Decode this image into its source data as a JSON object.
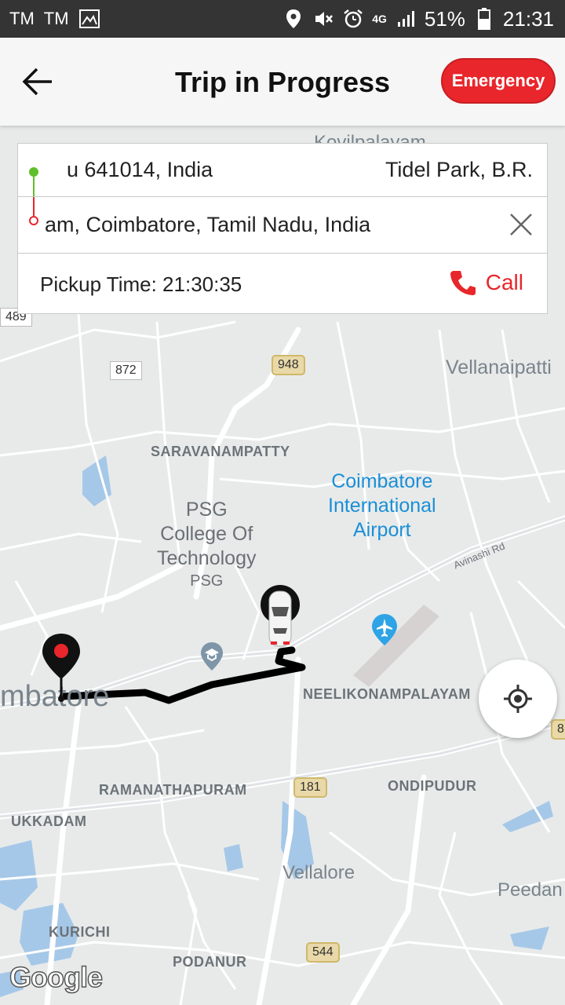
{
  "status_bar": {
    "left_labels": [
      "TM",
      "TM"
    ],
    "network": "4G",
    "battery": "51%",
    "time": "21:31"
  },
  "header": {
    "title": "Trip in Progress",
    "emergency_label": "Emergency"
  },
  "trip_card": {
    "pickup_address": "u 641014, India",
    "pickup_area": "Tidel Park, B.R.",
    "drop_address": "am, Coimbatore, Tamil Nadu, India",
    "pickup_time": "Pickup Time: 21:30:35",
    "call_label": "Call"
  },
  "map": {
    "labels": {
      "kovilpalayam": "Kovilpalayam",
      "vellanaipatti": "Vellanaipatti",
      "saravanampatty": "SARAVANAMPATTY",
      "airport_line1": "Coimbatore",
      "airport_line2": "International",
      "airport_line3": "Airport",
      "psg_line1": "PSG",
      "psg_line2": "College Of",
      "psg_line3": "Technology",
      "psg_line4": "PSG",
      "avinashi": "Avinashi Rd",
      "neelikonampalayam": "NEELIKONAMPALAYAM",
      "coimbatore": "mbatore",
      "ramanathapuram": "RAMANATHAPURAM",
      "ondipudur": "ONDIPUDUR",
      "ukkadam": "UKKADAM",
      "vellalore": "Vellalore",
      "peedam": "Peedan",
      "kurichi": "KURICHI",
      "podanur": "PODANUR",
      "attribution": "Google"
    },
    "shields": {
      "r489": "489",
      "r872": "872",
      "r948": "948",
      "r181": "181",
      "r544": "544",
      "r8": "8"
    }
  },
  "colors": {
    "emergency": "#e8262b",
    "pickup_dot": "#5fbf2a",
    "drop_dot": "#e8262b",
    "route": "#000000",
    "water": "#a6c8e8"
  },
  "icons": [
    "back-arrow-icon",
    "close-icon",
    "phone-icon",
    "my-location-icon",
    "car-marker-icon",
    "destination-pin-icon",
    "airport-icon",
    "school-icon"
  ]
}
